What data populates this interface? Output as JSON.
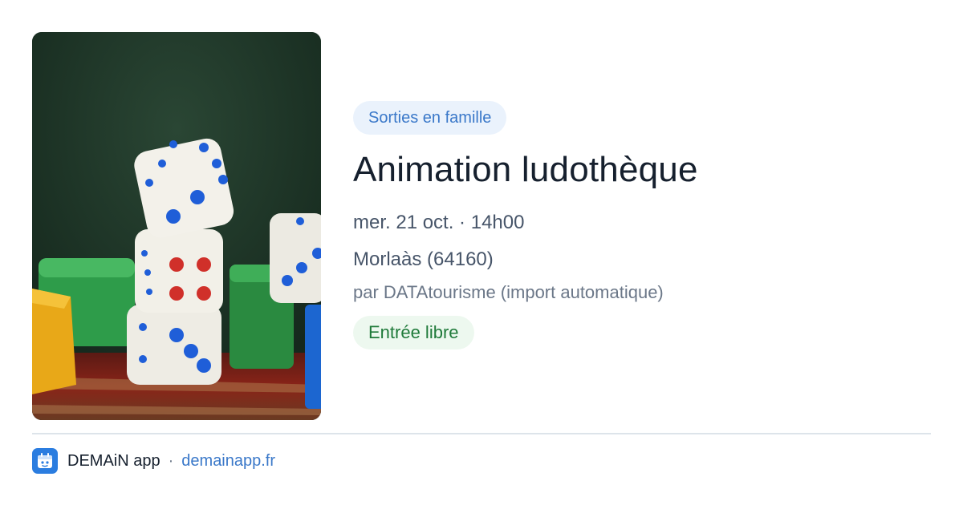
{
  "event": {
    "category": "Sorties en famille",
    "title": "Animation ludothèque",
    "datetime": "mer. 21 oct. · 14h00",
    "location": "Morlaàs (64160)",
    "source": "par DATAtourisme (import automatique)",
    "price": "Entrée libre"
  },
  "footer": {
    "app_name": "DEMAiN app",
    "separator": "·",
    "url": "demainapp.fr"
  },
  "colors": {
    "category_bg": "#eaf2fc",
    "category_text": "#3a78c9",
    "price_bg": "#edf8ef",
    "price_text": "#1f7a3a",
    "brand": "#2b7de0"
  },
  "icons": {
    "app_logo": "demain-logo-icon"
  }
}
